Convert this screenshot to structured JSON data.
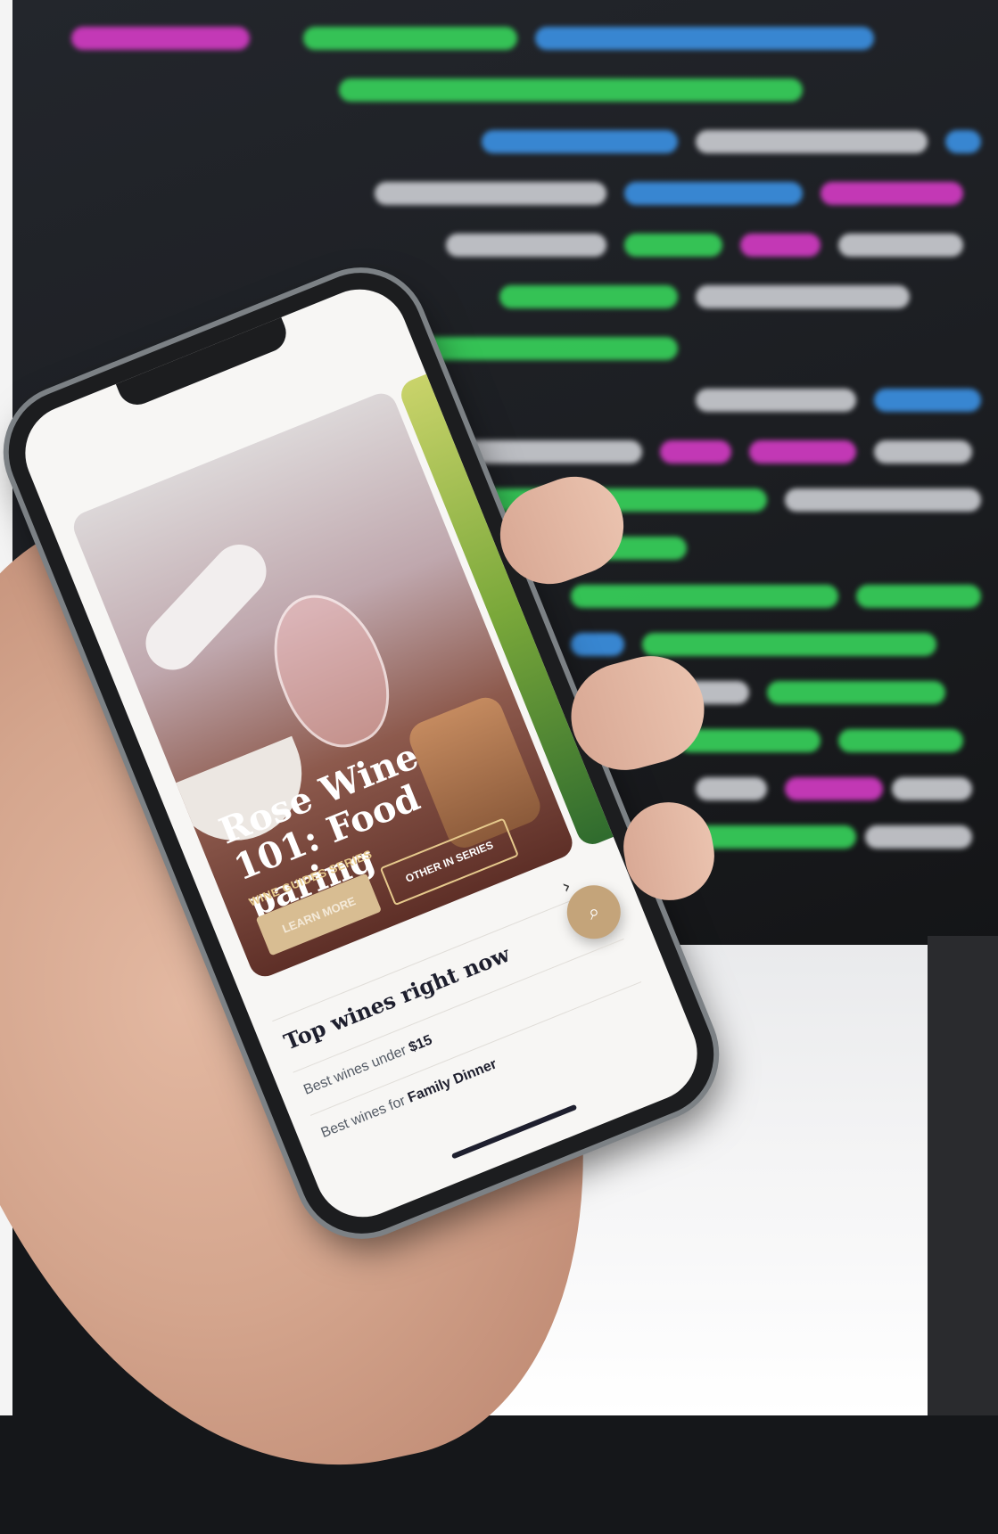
{
  "app": {
    "hero": {
      "title": "Rose Wine 101: Food paring",
      "series_label": "WINE GUIDES SERIES",
      "learn_more_label": "LEARN MORE",
      "other_series_label": "OTHER IN SERIES"
    },
    "top_wines": {
      "title": "Top wines right now",
      "items": [
        {
          "prefix": "Best wines under ",
          "highlight": "$15"
        },
        {
          "prefix": "Best wines for ",
          "highlight": "Family Dinner"
        }
      ]
    },
    "icons": {
      "next": "chevron-right-icon",
      "search": "search-icon"
    },
    "colors": {
      "accent_gold": "#c4a47a",
      "learn_button": "#d8bd92",
      "title_navy": "#1e1f2e",
      "code_green": "#37d05a",
      "code_blue": "#3b8fe0",
      "code_pink": "#d13bc2"
    }
  }
}
